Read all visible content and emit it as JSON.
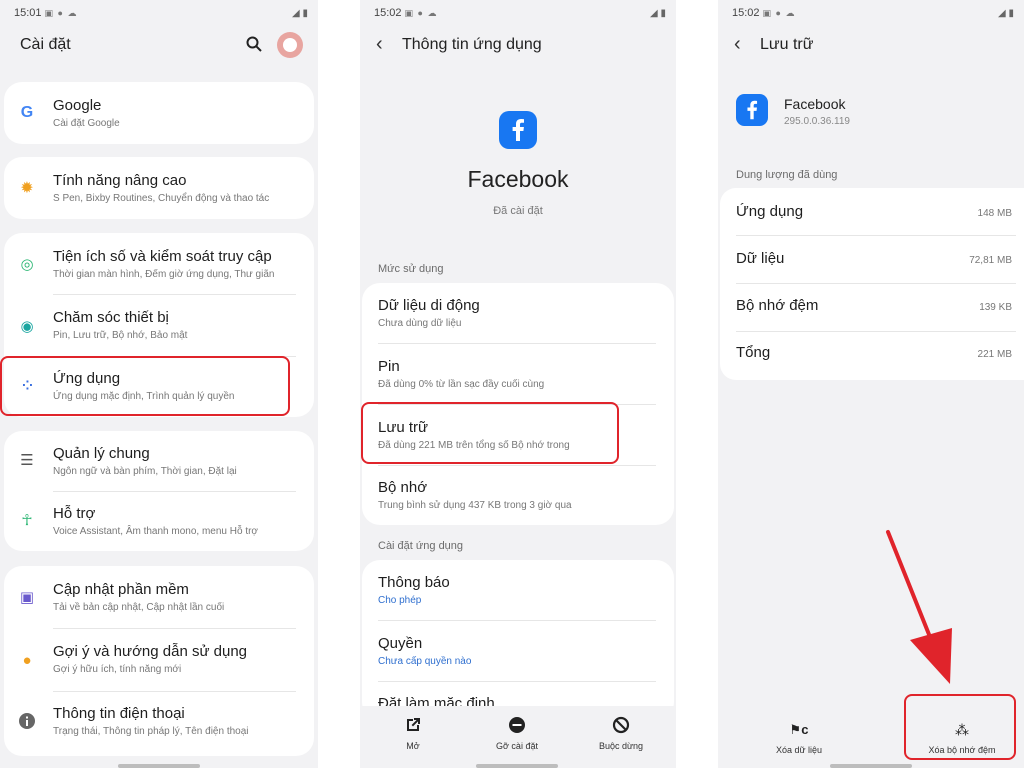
{
  "screen1": {
    "status_time": "15:01",
    "title": "Cài đặt",
    "items": [
      {
        "label": "Google",
        "sub": "Cài đặt Google"
      },
      {
        "label": "Tính năng nâng cao",
        "sub": "S Pen, Bixby Routines, Chuyển động và thao tác"
      },
      {
        "label": "Tiện ích số và kiểm soát truy cập",
        "sub": "Thời gian màn hình, Đếm giờ ứng dụng, Thư giãn"
      },
      {
        "label": "Chăm sóc thiết bị",
        "sub": "Pin, Lưu trữ, Bộ nhớ, Bảo mật"
      },
      {
        "label": "Ứng dụng",
        "sub": "Ứng dụng mặc định, Trình quản lý quyền"
      },
      {
        "label": "Quản lý chung",
        "sub": "Ngôn ngữ và bàn phím, Thời gian, Đặt lại"
      },
      {
        "label": "Hỗ trợ",
        "sub": "Voice Assistant, Âm thanh mono, menu Hỗ trợ"
      },
      {
        "label": "Cập nhật phần mềm",
        "sub": "Tải về bản cập nhật, Cập nhật lần cuối"
      },
      {
        "label": "Gợi ý và hướng dẫn sử dụng",
        "sub": "Gợi ý hữu ích, tính năng mới"
      },
      {
        "label": "Thông tin điện thoại",
        "sub": "Trạng thái, Thông tin pháp lý, Tên điện thoại"
      }
    ]
  },
  "screen2": {
    "status_time": "15:02",
    "title": "Thông tin ứng dụng",
    "app_name": "Facebook",
    "app_status": "Đã cài đặt",
    "section_usage": "Mức sử dụng",
    "usage_items": [
      {
        "label": "Dữ liệu di động",
        "sub": "Chưa dùng dữ liệu"
      },
      {
        "label": "Pin",
        "sub": "Đã dùng 0% từ lần sạc đầy cuối cùng"
      },
      {
        "label": "Lưu trữ",
        "sub": "Đã dùng 221 MB trên tổng số Bộ nhớ trong"
      },
      {
        "label": "Bộ nhớ",
        "sub": "Trung bình sử dụng 437 KB trong 3 giờ qua"
      }
    ],
    "section_settings": "Cài đặt ứng dụng",
    "settings_items": [
      {
        "label": "Thông báo",
        "sub": "Cho phép"
      },
      {
        "label": "Quyền",
        "sub": "Chưa cấp quyền nào"
      },
      {
        "label": "Đặt làm mặc định",
        "sub": ""
      }
    ],
    "actions": [
      {
        "label": "Mở"
      },
      {
        "label": "Gỡ cài đặt"
      },
      {
        "label": "Buộc dừng"
      }
    ]
  },
  "screen3": {
    "status_time": "15:02",
    "title": "Lưu trữ",
    "app_name": "Facebook",
    "app_version": "295.0.0.36.119",
    "section_used": "Dung lượng đã dùng",
    "rows": [
      {
        "label": "Ứng dụng",
        "value": "148 MB"
      },
      {
        "label": "Dữ liệu",
        "value": "72,81 MB"
      },
      {
        "label": "Bộ nhớ đệm",
        "value": "139 KB"
      },
      {
        "label": "Tổng",
        "value": "221 MB"
      }
    ],
    "actions": [
      {
        "label": "Xóa dữ liệu"
      },
      {
        "label": "Xóa bộ nhớ đệm"
      }
    ]
  },
  "colors": {
    "highlight": "#e0242b",
    "facebook_blue": "#1877f2",
    "link_blue": "#2f6fcf"
  }
}
